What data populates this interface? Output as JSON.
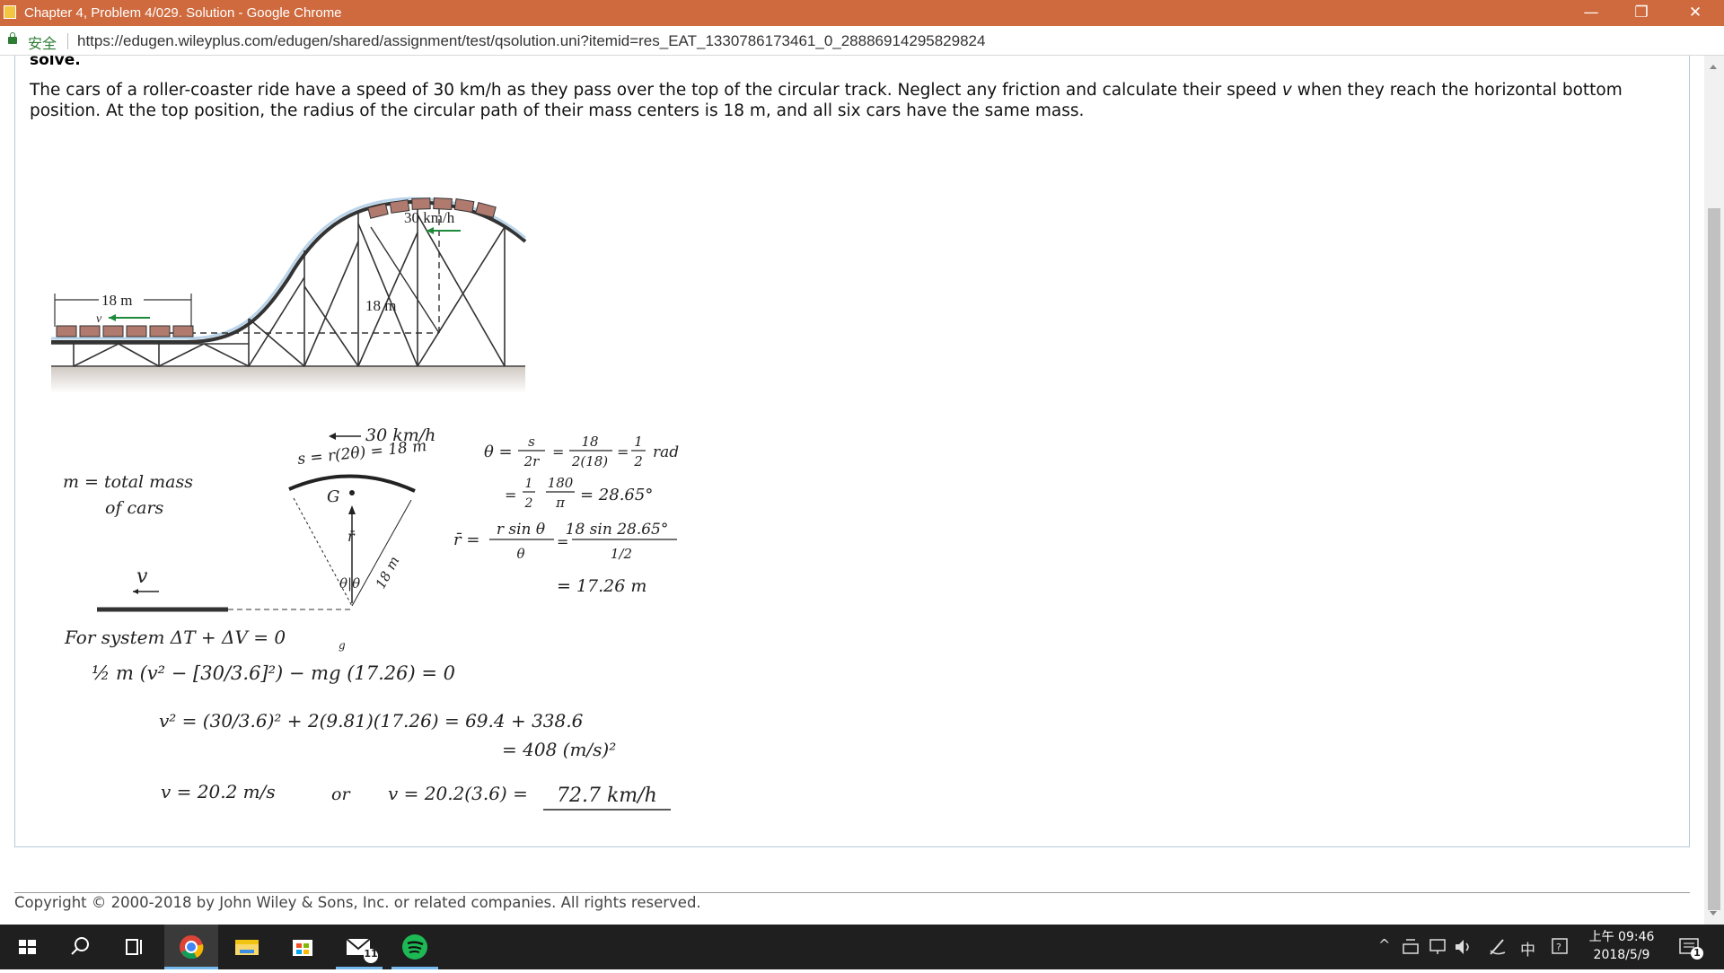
{
  "window": {
    "title": "Chapter 4, Problem 4/029. Solution - Google Chrome",
    "minimize": "—",
    "restore": "❐",
    "close": "✕"
  },
  "address": {
    "secure_label": "安全",
    "url": "https://edugen.wileyplus.com/edugen/shared/assignment/test/qsolution.uni?itemid=res_EAT_1330786173461_0_28886914295829824"
  },
  "problem": {
    "heading": "solve.",
    "text_part1": "The cars of a roller-coaster ride have a speed of 30 km/h as they pass over the top of the circular track. Neglect any friction and calculate their speed ",
    "text_var": "v",
    "text_part2": " when they reach the horizontal bottom position. At the top position, the radius of the circular path of their mass centers is 18 m, and all six cars have the same mass."
  },
  "figure": {
    "speed_top": "30 km/h",
    "radius_label": "18 m",
    "length_label": "18 m",
    "speed_bottom": "v"
  },
  "solution": {
    "m_def1": "m = total mass",
    "m_def2": "of cars",
    "v_label": "v",
    "speed_arrow": "30 km/h",
    "s_eq": "s = r(2θ) = 18 m",
    "G_label": "G",
    "rbar_label": "r̄",
    "theta_label": "θ|θ",
    "r_side": "18 m",
    "theta_eq1": "θ =",
    "theta_f1_num": "s",
    "theta_f1_den": "2r",
    "theta_eq2": "=",
    "theta_f2_num": "18",
    "theta_f2_den": "2(18)",
    "theta_eq3": "=",
    "theta_f3_num": "1",
    "theta_f3_den": "2",
    "theta_unit": "rad",
    "theta2_eq": "=",
    "theta2_f1_num": "1",
    "theta2_f1_den": "2",
    "theta2_f2_num": "180",
    "theta2_f2_den": "π",
    "theta2_result": "= 28.65°",
    "rbar_eq": "r̄ =",
    "rbar_f1_num": "r sin θ",
    "rbar_f1_den": "θ",
    "rbar_eq2": "=",
    "rbar_f2_num": "18 sin 28.65°",
    "rbar_f2_den": "1/2",
    "rbar_result": "= 17.26 m",
    "sys_line": "For   system      ΔT + ΔV  = 0",
    "sys_sub": "g",
    "energy_line": "½ m (v² − [30/3.6]²)  −   mg (17.26) = 0",
    "v2_line": "v² = (30/3.6)² + 2(9.81)(17.26)   = 69.4 + 338.6",
    "v2_result": "= 408  (m/s)²",
    "v_ms": "v = 20.2 m/s",
    "or_label": "or",
    "v_kmh_prefix": "v = 20.2(3.6) =",
    "v_kmh_answer": "72.7 km/h"
  },
  "footer": {
    "copyright": "Copyright © 2000-2018 by John Wiley & Sons, Inc. or related companies. All rights reserved."
  },
  "taskbar": {
    "mail_badge": "11",
    "ime_char": "中",
    "clock_time": "上午 09:46",
    "clock_date": "2018/5/9",
    "notif_badge": "1"
  }
}
